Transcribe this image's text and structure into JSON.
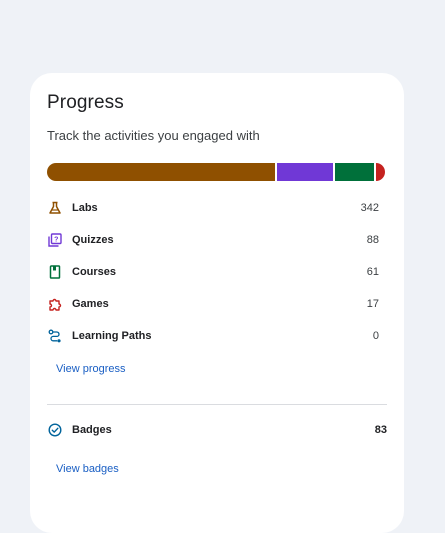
{
  "progress": {
    "title": "Progress",
    "subtitle": "Track the activities you engaged with",
    "bar_segments": [
      {
        "name": "Labs",
        "value": 342,
        "color": "#8f5000"
      },
      {
        "name": "Quizzes",
        "value": 88,
        "color": "#7038d6"
      },
      {
        "name": "Courses",
        "value": 61,
        "color": "#00703a"
      },
      {
        "name": "Games",
        "value": 17,
        "color": "#c5221f"
      },
      {
        "name": "Learning Paths",
        "value": 0,
        "color": "#00639b"
      }
    ],
    "items": [
      {
        "label": "Labs",
        "count": "342",
        "icon": "flask-icon",
        "color": "#8f5000"
      },
      {
        "label": "Quizzes",
        "count": "88",
        "icon": "quiz-icon",
        "color": "#7038d6"
      },
      {
        "label": "Courses",
        "count": "61",
        "icon": "book-icon",
        "color": "#00703a"
      },
      {
        "label": "Games",
        "count": "17",
        "icon": "puzzle-icon",
        "color": "#c5221f"
      },
      {
        "label": "Learning Paths",
        "count": "0",
        "icon": "route-icon",
        "color": "#00639b"
      }
    ],
    "view_progress_label": "View progress"
  },
  "badges": {
    "label": "Badges",
    "count": "83",
    "icon": "check-circle-icon",
    "view_badges_label": "View badges"
  }
}
